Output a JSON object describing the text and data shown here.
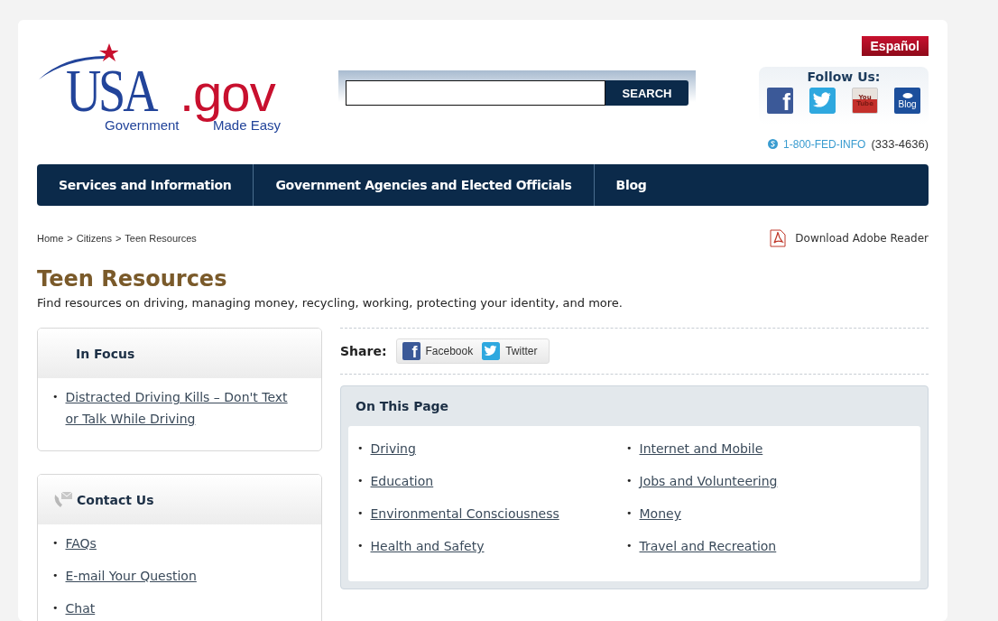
{
  "language_link": "Español",
  "bullet": "•",
  "logo": {
    "name": "USA",
    "suffix": ".gov",
    "tagline_left": "Government",
    "tagline_right": "Made Easy"
  },
  "search": {
    "button": "SEARCH"
  },
  "follow": {
    "title": "Follow Us:",
    "icons": [
      {
        "kind": "facebook",
        "glyph": "f"
      },
      {
        "kind": "twitter"
      },
      {
        "kind": "youtube",
        "glyph": "You Tube"
      },
      {
        "kind": "blog",
        "glyph": "Blog"
      }
    ]
  },
  "phone": {
    "number": "1-800-FED-INFO",
    "digits": "(333-4636)"
  },
  "nav": [
    "Services and Information",
    "Government Agencies and Elected Officials",
    "Blog"
  ],
  "breadcrumb": {
    "items": [
      "Home",
      "Citizens",
      "Teen Resources"
    ],
    "separator": ">"
  },
  "download": "Download Adobe Reader",
  "page": {
    "title": "Teen Resources",
    "description": "Find resources on driving, managing money, recycling, working, protecting your identity, and more."
  },
  "in_focus": {
    "title": "In Focus",
    "links": [
      "Distracted Driving Kills – Don't Text or Talk While Driving"
    ]
  },
  "contact": {
    "title": "Contact Us",
    "links": [
      "FAQs",
      "E-mail Your Question",
      "Chat"
    ]
  },
  "share": {
    "label": "Share:",
    "buttons": [
      {
        "kind": "facebook",
        "glyph": "f",
        "label": "Facebook"
      },
      {
        "kind": "twitter",
        "label": "Twitter"
      }
    ]
  },
  "on_this_page": {
    "title": "On This Page",
    "columns": [
      [
        "Driving",
        "Education",
        "Environmental Consciousness",
        "Health and Safety"
      ],
      [
        "Internet and Mobile",
        "Jobs and Volunteering",
        "Money",
        "Travel and Recreation"
      ]
    ]
  }
}
